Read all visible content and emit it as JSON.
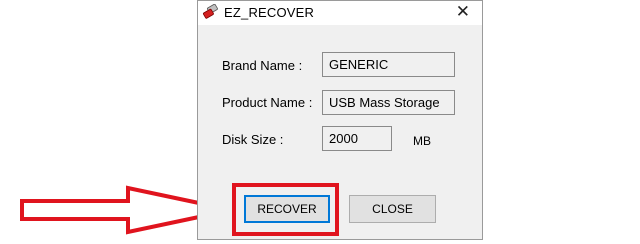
{
  "window": {
    "title": "EZ_RECOVER",
    "close_glyph": "✕"
  },
  "fields": {
    "brand_label": "Brand Name :",
    "brand_value": "GENERIC",
    "product_label": "Product Name :",
    "product_value": "USB Mass Storage",
    "disk_label": "Disk Size :",
    "disk_value": "2000",
    "disk_unit": "MB"
  },
  "buttons": {
    "recover": "RECOVER",
    "close": "CLOSE"
  },
  "annotation": {
    "highlight_color": "#e0141e"
  }
}
